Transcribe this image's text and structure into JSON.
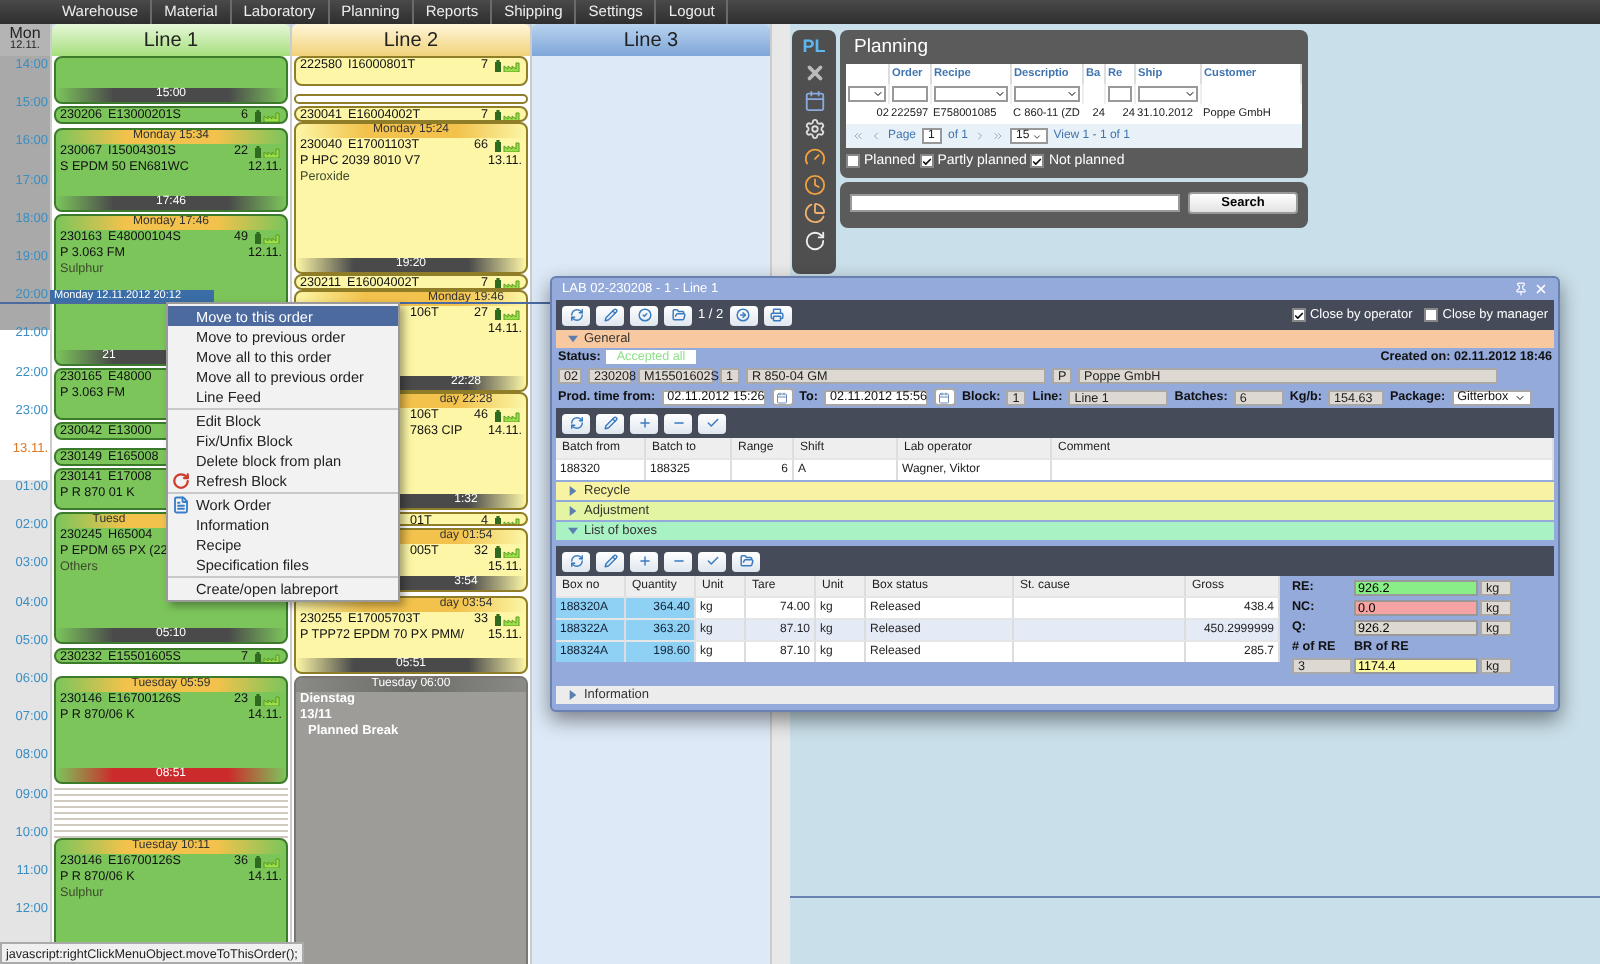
{
  "nav": [
    "Warehouse",
    "Material",
    "Laboratory",
    "Planning",
    "Reports",
    "Shipping",
    "Settings",
    "Logout"
  ],
  "schedule": {
    "day": "Mon",
    "date": "12.11.",
    "now_label": "Monday 12.11.2012 20:12",
    "hours": [
      {
        "label": "14:00",
        "kind": "hour"
      },
      {
        "label": "15:00",
        "kind": "hour"
      },
      {
        "label": "16:00",
        "kind": "hour"
      },
      {
        "label": "17:00",
        "kind": "hour"
      },
      {
        "label": "18:00",
        "kind": "hour"
      },
      {
        "label": "19:00",
        "kind": "hour"
      },
      {
        "label": "20:00",
        "kind": "hour"
      },
      {
        "label": "21:00",
        "kind": "hour"
      },
      {
        "label": "22:00",
        "kind": "hour"
      },
      {
        "label": "23:00",
        "kind": "hour"
      },
      {
        "label": "13.11.",
        "kind": "date"
      },
      {
        "label": "01:00",
        "kind": "hour"
      },
      {
        "label": "02:00",
        "kind": "hour"
      },
      {
        "label": "03:00",
        "kind": "hour"
      },
      {
        "label": "04:00",
        "kind": "hour"
      },
      {
        "label": "05:00",
        "kind": "hour"
      },
      {
        "label": "06:00",
        "kind": "hour"
      },
      {
        "label": "07:00",
        "kind": "hour"
      },
      {
        "label": "08:00",
        "kind": "hour"
      },
      {
        "label": "09:00",
        "kind": "hour"
      },
      {
        "label": "10:00",
        "kind": "hour"
      },
      {
        "label": "11:00",
        "kind": "hour"
      },
      {
        "label": "12:00",
        "kind": "hour"
      }
    ],
    "lines": [
      {
        "name": "Line 1",
        "blocks": [
          {
            "kind": "order",
            "end": "15:00",
            "late": false
          },
          {
            "kind": "slim",
            "order": "230206",
            "material": "E13000201S",
            "qty": "6"
          },
          {
            "kind": "order",
            "header": "Monday 15:34",
            "order": "230067",
            "material": "I15004301S",
            "qty": "22",
            "recipe": "S EPDM 50 EN681WC",
            "date": "12.11.",
            "end": "17:46",
            "late": false
          },
          {
            "kind": "order",
            "header": "Monday 17:46",
            "order": "230163",
            "material": "E48000104S",
            "qty": "49",
            "recipe": "P 3.063 FM",
            "date": "12.11.",
            "note": "Sulphur",
            "end": "21",
            "late": false
          },
          {
            "kind": "order",
            "order": "230165",
            "material": "E48000",
            "recipe": "P 3.063 FM"
          },
          {
            "kind": "slim",
            "order": "230042",
            "material": "E13000"
          },
          {
            "kind": "slim",
            "order": "230149",
            "material": "E165008"
          },
          {
            "kind": "order",
            "order": "230141",
            "material": "E17008",
            "recipe": "P R 870 01 K"
          },
          {
            "kind": "order",
            "header": "Tuesd",
            "order": "230245",
            "material": "H65004",
            "recipe": "P EPDM 65 PX (22",
            "note": "Others",
            "end": "05:10",
            "late": false
          },
          {
            "kind": "slim",
            "order": "230232",
            "material": "E15501605S",
            "qty": "7"
          },
          {
            "kind": "order",
            "header": "Tuesday 05:59",
            "order": "230146",
            "material": "E16700126S",
            "qty": "23",
            "recipe": "P R 870/06 K",
            "date": "14.11.",
            "end": "08:51",
            "late": true
          },
          {
            "kind": "idle"
          },
          {
            "kind": "order",
            "header": "Tuesday 10:11",
            "order": "230146",
            "material": "E16700126S",
            "qty": "36",
            "recipe": "P R 870/06 K",
            "date": "14.11.",
            "note": "Sulphur"
          }
        ]
      },
      {
        "name": "Line 2",
        "blocks": [
          {
            "kind": "slim",
            "order": "222580",
            "material": "I16000801T",
            "qty": "7"
          },
          {
            "kind": "gap"
          },
          {
            "kind": "slim",
            "order": "230041",
            "material": "E16004002T",
            "qty": "7"
          },
          {
            "kind": "order",
            "header": "Monday 15:24",
            "order": "230040",
            "material": "E17001103T",
            "qty": "66",
            "recipe": "P HPC 2039 8010 V7",
            "date": "13.11.",
            "note": "Peroxide",
            "end": "19:20",
            "late": false
          },
          {
            "kind": "slim",
            "order": "230211",
            "material": "E16004002T",
            "qty": "7"
          },
          {
            "kind": "order",
            "header": "Monday 19:46",
            "material": "106T",
            "qty": "27",
            "date": "14.11.",
            "end": "22:28",
            "late": false
          },
          {
            "kind": "order",
            "header": "day 22:28",
            "material": "106T",
            "qty": "46",
            "recipe": "7863 CIP",
            "date": "14.11.",
            "end": "1:32",
            "late": false
          },
          {
            "kind": "slim",
            "material": "01T",
            "qty": "4"
          },
          {
            "kind": "order",
            "header": "day 01:54",
            "material": "005T",
            "qty": "32",
            "date": "15.11.",
            "end": "3:54",
            "late": false
          },
          {
            "kind": "order",
            "header": "day 03:54",
            "order": "230255",
            "material": "E17005703T",
            "qty": "33",
            "recipe": "P TPP72 EPDM 70 PX PMM/",
            "date": "15.11.",
            "end": "05:51",
            "late": false
          },
          {
            "kind": "break",
            "header": "Tuesday 06:00",
            "lines": [
              "Dienstag",
              "13/11",
              "Planned Break"
            ]
          }
        ]
      },
      {
        "name": "Line 3"
      }
    ]
  },
  "context_menu": {
    "groups": [
      [
        {
          "label": "Move to this order",
          "selected": true,
          "kind": "plain"
        },
        {
          "label": "Move to previous order",
          "selected": false,
          "kind": "plain"
        },
        {
          "label": "Move all to this order",
          "selected": false,
          "kind": "plain"
        },
        {
          "label": "Move all to previous order",
          "selected": false,
          "kind": "plain"
        },
        {
          "label": "Line Feed",
          "selected": false,
          "kind": "plain"
        }
      ],
      [
        {
          "label": "Edit Block",
          "selected": false,
          "kind": "plain"
        },
        {
          "label": "Fix/Unfix Block",
          "selected": false,
          "kind": "plain"
        },
        {
          "label": "Delete block from plan",
          "selected": false,
          "kind": "plain"
        },
        {
          "label": "Refresh Block",
          "selected": false,
          "kind": "refresh"
        }
      ],
      [
        {
          "label": "Work Order",
          "selected": false,
          "kind": "document"
        },
        {
          "label": "Information",
          "selected": false,
          "kind": "plain"
        },
        {
          "label": "Recipe",
          "selected": false,
          "kind": "plain"
        },
        {
          "label": "Specification files",
          "selected": false,
          "kind": "plain"
        }
      ],
      [
        {
          "label": "Create/open labreport",
          "selected": false,
          "kind": "plain"
        }
      ]
    ]
  },
  "tool_strip": {
    "label": "PL"
  },
  "planning": {
    "title": "Planning",
    "columns": [
      "",
      "Order",
      "Recipe",
      "Descriptio",
      "Ba",
      "Re",
      "Ship",
      "Customer"
    ],
    "rows": [
      [
        "02",
        "222597",
        "E758001085",
        "C 860-11 (ZD",
        "24",
        "24",
        "31.10.2012",
        "Poppe GmbH"
      ]
    ],
    "pager": {
      "page_label": "Page",
      "page": "1",
      "of": "of 1",
      "size": "15",
      "view": "View 1 - 1 of 1"
    },
    "filters": [
      {
        "label": "Planned",
        "checked": false
      },
      {
        "label": "Partly planned",
        "checked": true
      },
      {
        "label": "Not planned",
        "checked": true
      }
    ]
  },
  "search": {
    "button": "Search"
  },
  "dialog": {
    "title": "LAB 02-230208 - 1 - Line 1",
    "pager": "1 / 2",
    "close_options": [
      {
        "label": "Close by operator",
        "checked": true
      },
      {
        "label": "Close by manager",
        "checked": false
      }
    ],
    "general": {
      "title": "General",
      "expanded": true,
      "status_label": "Status:",
      "status": "Accepted all",
      "created": "Created on: 02.11.2012 18:46",
      "ids": [
        "02",
        "230208",
        "M15501602S",
        "1",
        "R 850-04 GM",
        "P",
        "Poppe GmbH"
      ],
      "fields": [
        {
          "label": "Prod. time from:",
          "value": "02.11.2012 15:26",
          "kind": "date"
        },
        {
          "label": "To:",
          "value": "02.11.2012 15:56",
          "kind": "date"
        },
        {
          "label": "Block:",
          "value": "1",
          "kind": "text"
        },
        {
          "label": "Line:",
          "value": "Line 1",
          "kind": "text"
        },
        {
          "label": "Batches:",
          "value": "6",
          "kind": "text"
        },
        {
          "label": "Kg/b:",
          "value": "154.63",
          "kind": "text"
        },
        {
          "label": "Package:",
          "value": "Gitterbox",
          "kind": "select"
        }
      ]
    },
    "batch_table": {
      "columns": [
        "Batch from",
        "Batch to",
        "Range",
        "Shift",
        "Lab operator",
        "Comment"
      ],
      "rows": [
        [
          "188320",
          "188325",
          "6",
          "A",
          "Wagner, Viktor",
          ""
        ]
      ]
    },
    "sections": [
      {
        "title": "Recycle",
        "expanded": false,
        "color": "#f8f3a2"
      },
      {
        "title": "Adjustment",
        "expanded": false,
        "color": "#e3f5a2"
      },
      {
        "title": "List of boxes",
        "expanded": true,
        "color": "#a9f2c4"
      }
    ],
    "boxes": {
      "columns": [
        "Box no",
        "Quantity",
        "Unit",
        "Tare",
        "Unit",
        "Box status",
        "St. cause",
        "Gross"
      ],
      "rows": [
        [
          "188320A",
          "364.40",
          "kg",
          "74.00",
          "kg",
          "Released",
          "",
          "438.4"
        ],
        [
          "188322A",
          "363.20",
          "kg",
          "87.10",
          "kg",
          "Released",
          "",
          "450.2999999"
        ],
        [
          "188324A",
          "198.60",
          "kg",
          "87.10",
          "kg",
          "Released",
          "",
          "285.7"
        ]
      ]
    },
    "totals": [
      {
        "label": "RE:",
        "value": "926.2",
        "unit": "kg",
        "color": "#8aee88"
      },
      {
        "label": "NC:",
        "value": "0.0",
        "unit": "kg",
        "color": "#f5a3a3"
      },
      {
        "label": "Q:",
        "value": "926.2",
        "unit": "kg",
        "color": "#ddd8d0"
      }
    ],
    "re_count": {
      "label": "# of RE",
      "value": "3"
    },
    "br": {
      "label": "BR of RE",
      "value": "1174.4",
      "unit": "kg"
    },
    "info": {
      "title": "Information",
      "expanded": false
    }
  },
  "status_bar": "javascript:rightClickMenuObject.moveToThisOrder();"
}
